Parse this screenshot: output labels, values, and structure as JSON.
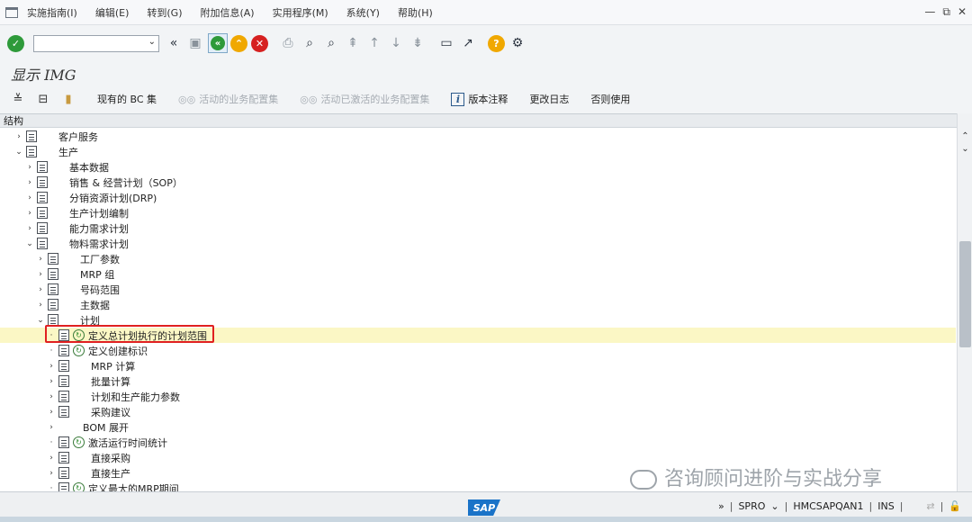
{
  "menu": {
    "items": [
      "实施指南(I)",
      "编辑(E)",
      "转到(G)",
      "附加信息(A)",
      "实用程序(M)",
      "系统(Y)",
      "帮助(H)"
    ]
  },
  "window_controls": {
    "minimize": "—",
    "restore": "⧉",
    "close": "✕"
  },
  "toolbar": {
    "command_field_value": "",
    "icons": [
      "check-icon",
      "back-double-icon",
      "save-icon",
      "back-icon",
      "exit-icon",
      "cancel-icon",
      "print-icon",
      "find-icon",
      "find-next-icon",
      "first-page-icon",
      "prev-page-icon",
      "next-page-icon",
      "last-page-icon",
      "new-session-icon",
      "shortcut-icon",
      "help-icon",
      "settings-icon"
    ]
  },
  "title": "显示 IMG",
  "app_toolbar": {
    "buttons": [
      {
        "label": "现有的 BC 集",
        "enabled": true
      },
      {
        "label": "活动的业务配置集",
        "enabled": false
      },
      {
        "label": "活动已激活的业务配置集",
        "enabled": false
      },
      {
        "label": "版本注释",
        "enabled": true
      },
      {
        "label": "更改日志",
        "enabled": true
      },
      {
        "label": "否则使用",
        "enabled": true
      }
    ]
  },
  "tree": {
    "header": "结构",
    "rows": [
      {
        "level": 1,
        "expander": "›",
        "icons": [
          "doc"
        ],
        "label": "客户服务"
      },
      {
        "level": 1,
        "expander": "⌄",
        "icons": [
          "doc"
        ],
        "label": "生产"
      },
      {
        "level": 2,
        "expander": "›",
        "icons": [
          "doc"
        ],
        "label": "基本数据"
      },
      {
        "level": 2,
        "expander": "›",
        "icons": [
          "doc"
        ],
        "label": "销售 & 经营计划（SOP）"
      },
      {
        "level": 2,
        "expander": "›",
        "icons": [
          "doc"
        ],
        "label": "分销资源计划(DRP)"
      },
      {
        "level": 2,
        "expander": "›",
        "icons": [
          "doc"
        ],
        "label": "生产计划编制"
      },
      {
        "level": 2,
        "expander": "›",
        "icons": [
          "doc"
        ],
        "label": "能力需求计划"
      },
      {
        "level": 2,
        "expander": "⌄",
        "icons": [
          "doc"
        ],
        "label": "物料需求计划"
      },
      {
        "level": 3,
        "expander": "›",
        "icons": [
          "doc"
        ],
        "label": "工厂参数"
      },
      {
        "level": 3,
        "expander": "›",
        "icons": [
          "doc"
        ],
        "label": "MRP 组"
      },
      {
        "level": 3,
        "expander": "›",
        "icons": [
          "doc"
        ],
        "label": "号码范围"
      },
      {
        "level": 3,
        "expander": "›",
        "icons": [
          "doc"
        ],
        "label": "主数据"
      },
      {
        "level": 3,
        "expander": "⌄",
        "icons": [
          "doc"
        ],
        "label": "计划"
      },
      {
        "level": 4,
        "expander": "·",
        "icons": [
          "doc",
          "clock"
        ],
        "label": "定义总计划执行的计划范围",
        "highlight": true
      },
      {
        "level": 4,
        "expander": "·",
        "icons": [
          "doc",
          "clock"
        ],
        "label": "定义创建标识"
      },
      {
        "level": 4,
        "expander": "›",
        "icons": [
          "doc"
        ],
        "label": "MRP 计算"
      },
      {
        "level": 4,
        "expander": "›",
        "icons": [
          "doc"
        ],
        "label": "批量计算"
      },
      {
        "level": 4,
        "expander": "›",
        "icons": [
          "doc"
        ],
        "label": "计划和生产能力参数"
      },
      {
        "level": 4,
        "expander": "›",
        "icons": [
          "doc"
        ],
        "label": "采购建议"
      },
      {
        "level": 4,
        "expander": "›",
        "icons": [],
        "label": "BOM 展开"
      },
      {
        "level": 4,
        "expander": "·",
        "icons": [
          "doc",
          "clock"
        ],
        "label": "激活运行时间统计"
      },
      {
        "level": 4,
        "expander": "›",
        "icons": [
          "doc"
        ],
        "label": "直接采购"
      },
      {
        "level": 4,
        "expander": "›",
        "icons": [
          "doc"
        ],
        "label": "直接生产"
      },
      {
        "level": 4,
        "expander": "·",
        "icons": [
          "doc",
          "clock"
        ],
        "label": "定义最大的MRP期间"
      }
    ]
  },
  "status": {
    "logo": "SAP",
    "transaction": "SPRO",
    "server": "HMCSAPQAN1",
    "mode": "INS"
  },
  "watermark": "咨询顾问进阶与实战分享",
  "colors": {
    "accent_green": "#2e9a3a",
    "accent_yellow": "#f0a800",
    "accent_red": "#d62020",
    "highlight_row": "#fbf7c5",
    "selection_border": "#e02020",
    "sap_blue": "#1a73c8"
  }
}
